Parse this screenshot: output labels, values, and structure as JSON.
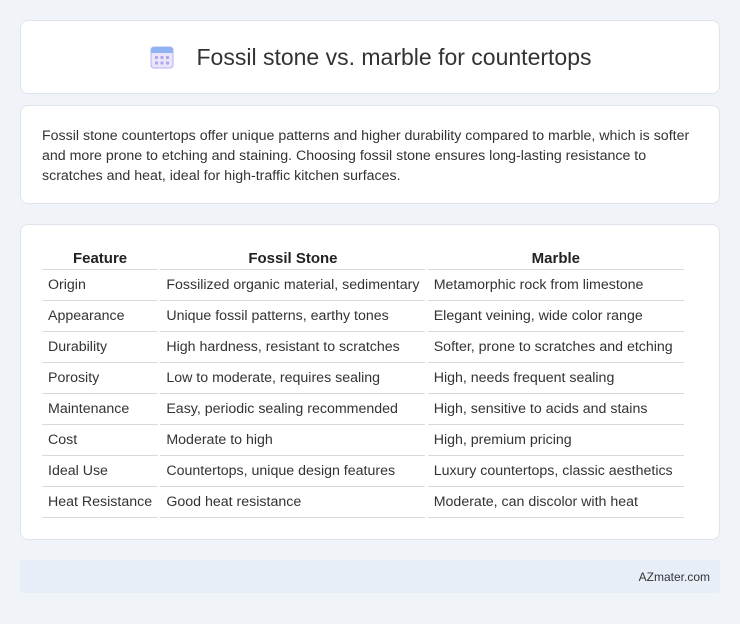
{
  "header": {
    "title": "Fossil stone vs. marble for countertops",
    "icon": "calendar-icon"
  },
  "intro": {
    "text": "Fossil stone countertops offer unique patterns and higher durability compared to marble, which is softer and more prone to etching and staining. Choosing fossil stone ensures long-lasting resistance to scratches and heat, ideal for high-traffic kitchen surfaces."
  },
  "table": {
    "columns": [
      "Feature",
      "Fossil Stone",
      "Marble"
    ],
    "rows": [
      [
        "Origin",
        "Fossilized organic material, sedimentary",
        "Metamorphic rock from limestone"
      ],
      [
        "Appearance",
        "Unique fossil patterns, earthy tones",
        "Elegant veining, wide color range"
      ],
      [
        "Durability",
        "High hardness, resistant to scratches",
        "Softer, prone to scratches and etching"
      ],
      [
        "Porosity",
        "Low to moderate, requires sealing",
        "High, needs frequent sealing"
      ],
      [
        "Maintenance",
        "Easy, periodic sealing recommended",
        "High, sensitive to acids and stains"
      ],
      [
        "Cost",
        "Moderate to high",
        "High, premium pricing"
      ],
      [
        "Ideal Use",
        "Countertops, unique design features",
        "Luxury countertops, classic aesthetics"
      ],
      [
        "Heat Resistance",
        "Good heat resistance",
        "Moderate, can discolor with heat"
      ]
    ]
  },
  "footer": {
    "brand": "AZmater.com"
  },
  "colors": {
    "page_bg": "#f0f3f8",
    "card_bg": "#ffffff",
    "footer_bg": "#e8eef8",
    "icon_accent": "#9b8fe0"
  }
}
